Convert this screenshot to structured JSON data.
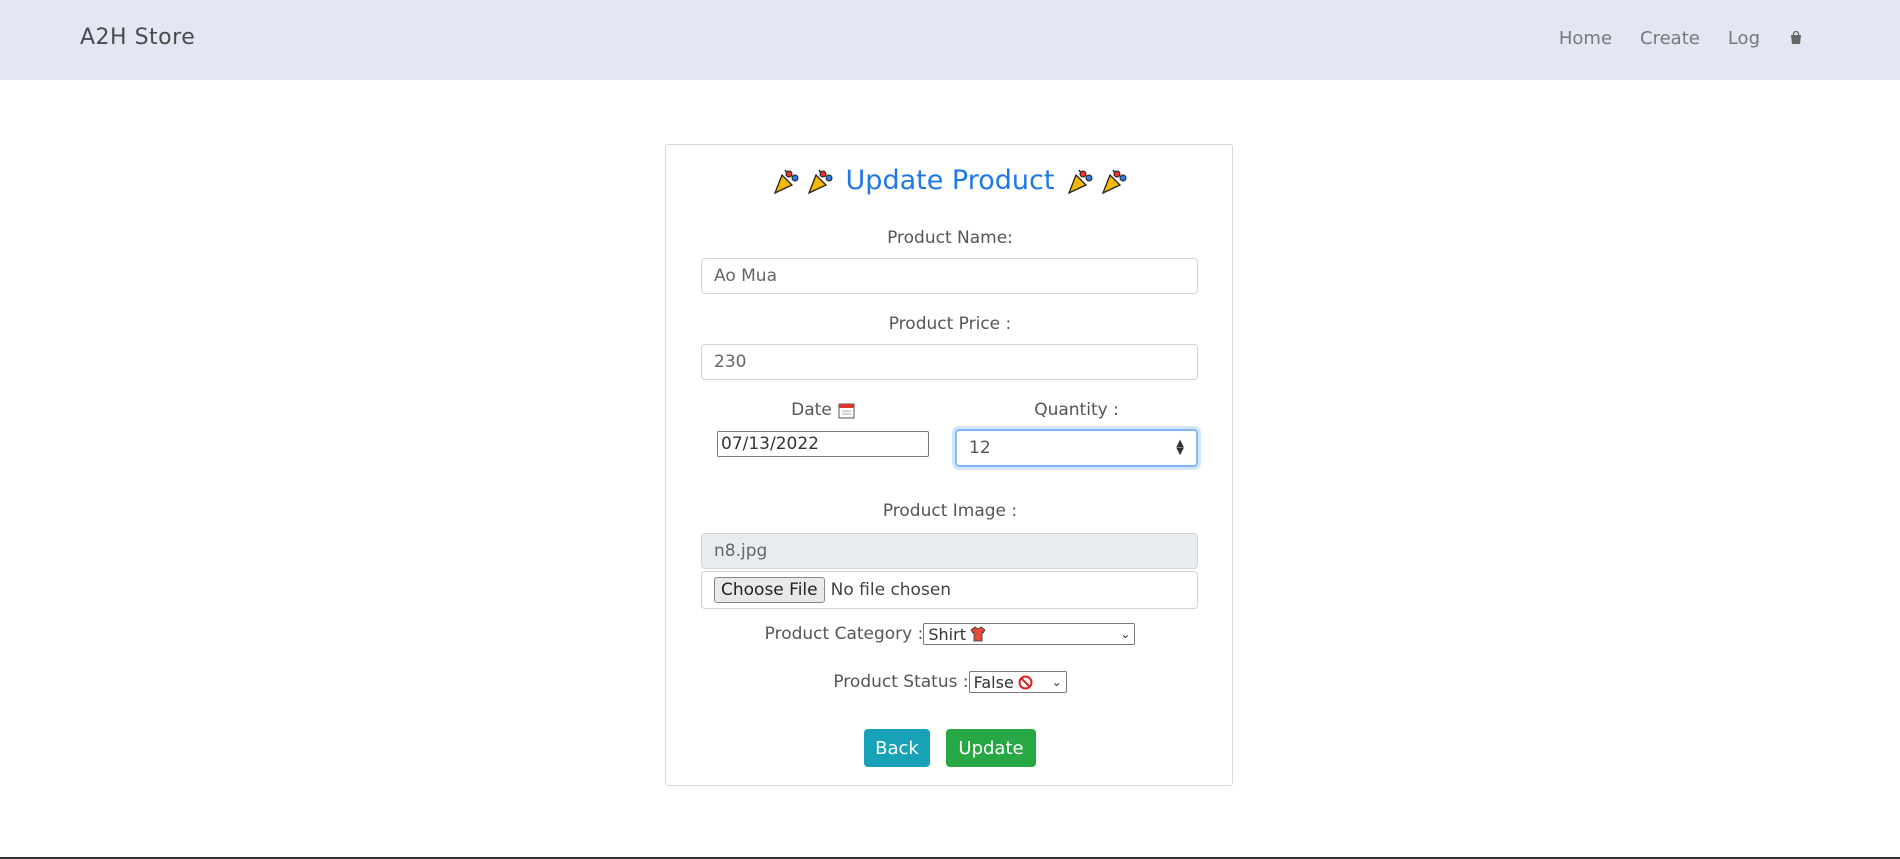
{
  "navbar": {
    "brand": "A2H Store",
    "links": [
      "Home",
      "Create",
      "Log"
    ],
    "cart_icon": "shopping-bag-icon"
  },
  "form": {
    "title": "Update Product",
    "decoration_icon": "party-popper-icon",
    "name_label": "Product Name:",
    "name_value": "Ao Mua",
    "price_label": "Product Price :",
    "price_value": "230",
    "date_label": "Date",
    "date_icon": "calendar-icon",
    "date_value": "07/13/2022",
    "quantity_label": "Quantity :",
    "quantity_value": "12",
    "image_label": "Product Image :",
    "image_current": "n8.jpg",
    "file_button": "Choose File",
    "file_status": "No file chosen",
    "category_label": "Product Category :",
    "category_value": "Shirt",
    "category_icon": "t-shirt-icon",
    "status_label": "Product Status :",
    "status_value": "False",
    "status_icon": "prohibited-icon",
    "back_button": "Back",
    "update_button": "Update"
  },
  "colors": {
    "navbar_bg": "#e3e7f3",
    "title": "#1f78e6",
    "back": "#17a2b8",
    "update": "#28a745"
  }
}
